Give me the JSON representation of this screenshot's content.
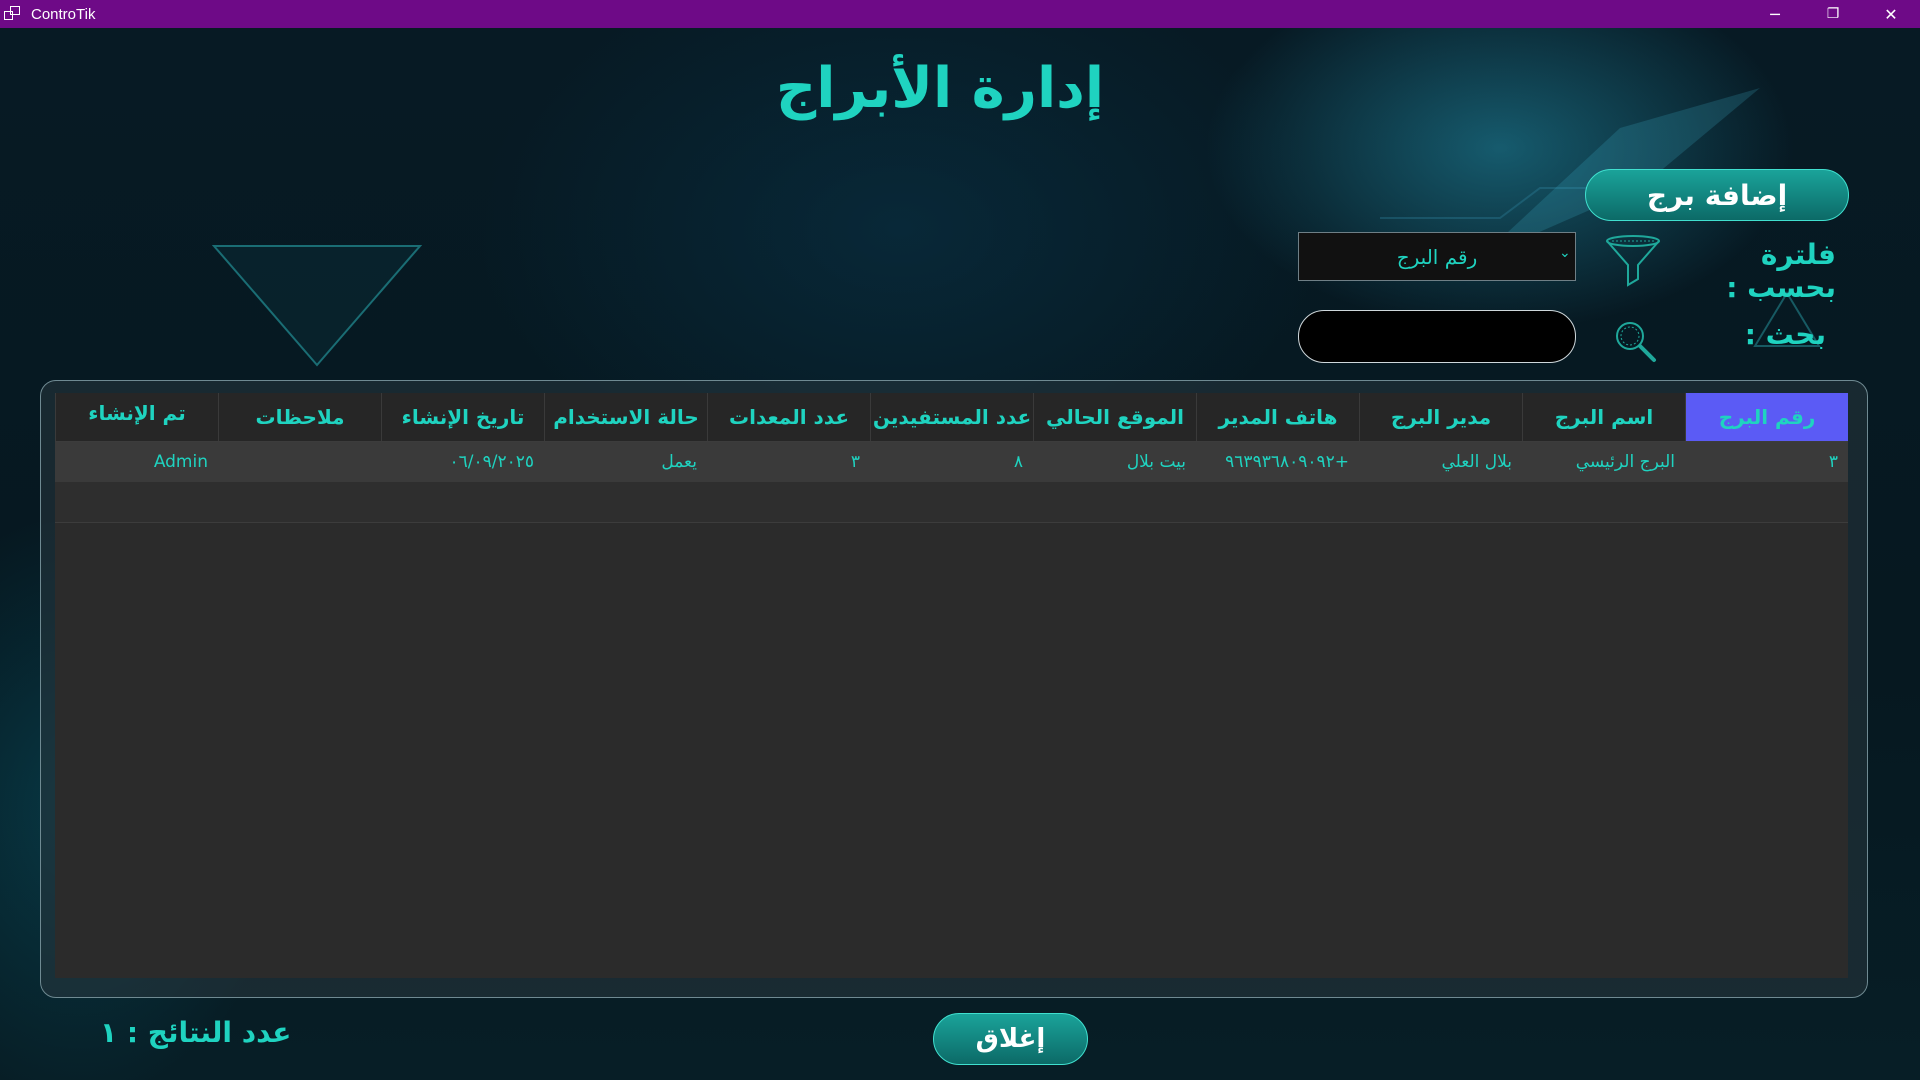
{
  "window": {
    "title": "ControTik",
    "minimize": "─",
    "restore": "❐",
    "close": "✕"
  },
  "page": {
    "title": "إدارة الأبراج"
  },
  "toolbar": {
    "add_button": "إضافة برج",
    "filter_label": "فلترة بحسب :",
    "filter_selected": "رقم البرج",
    "search_label": "بحث :",
    "search_value": ""
  },
  "table": {
    "headers": [
      "رقم البرج",
      "اسم البرج",
      "مدير البرج",
      "هاتف المدير",
      "الموقع الحالي",
      "عدد المستفيدين",
      "عدد المعدات",
      "حالة الاستخدام",
      "تاريخ الإنشاء",
      "ملاحظات",
      "تم الإنشاء"
    ],
    "active_header": "رقم البرج",
    "rows": [
      [
        "٣",
        "البرج الرئيسي",
        "بلال العلي",
        "+٩٦٣٩٣٦٨٠٩٠٩٢",
        "بيت بلال",
        "٨",
        "٣",
        "يعمل",
        "٠٦/٠٩/٢٠٢٥",
        "",
        "Admin"
      ]
    ]
  },
  "footer": {
    "count_label": "عدد النتائج : ١",
    "close_button": "إغلاق"
  },
  "colors": {
    "accent": "#1fd3c0",
    "titlebar": "#6e0a87",
    "active_header": "#5b5bf5"
  }
}
